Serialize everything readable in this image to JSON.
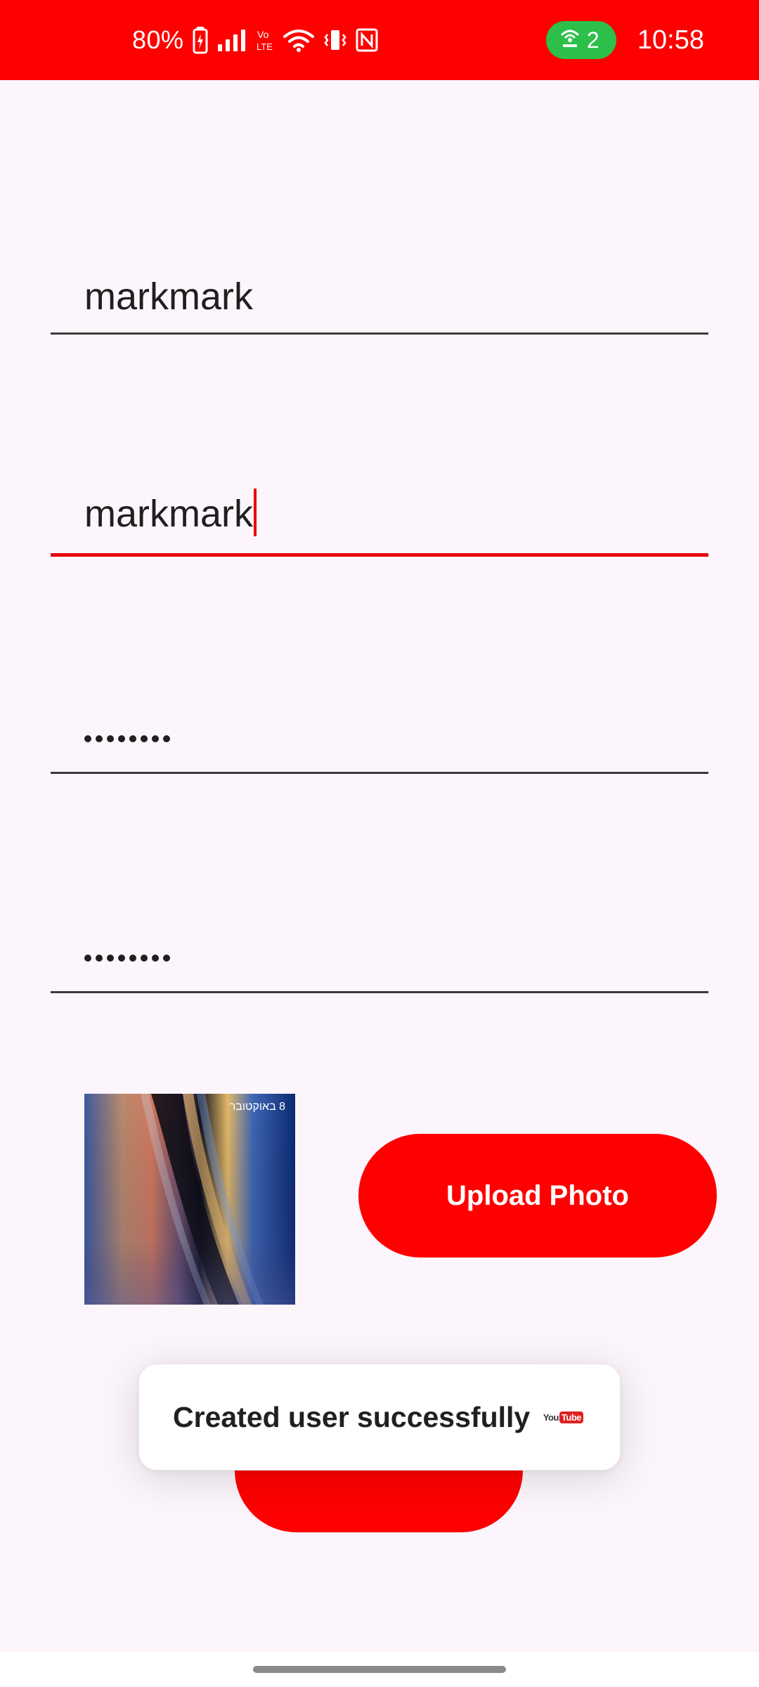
{
  "status_bar": {
    "battery_percent": "80%",
    "network_label": "Vo LTE",
    "hotspot_count": "2",
    "time": "10:58",
    "icons": [
      "battery-charging-icon",
      "signal-bars-icon",
      "volte-icon",
      "wifi-icon",
      "vibrate-icon",
      "nfc-icon",
      "hotspot-icon"
    ]
  },
  "form": {
    "username_value": "markmark",
    "email_value": "markmark",
    "password_dots": 8,
    "confirm_password_dots": 8
  },
  "photo": {
    "overlay_text": "8 באוקטובר"
  },
  "upload_button": {
    "label": "Upload Photo"
  },
  "toast": {
    "message": "Created user successfully",
    "icon": "youtube-logo-icon",
    "logo_you": "You",
    "logo_tube": "Tube"
  },
  "colors": {
    "primary": "#FF0000",
    "background": "#FCF6FC",
    "focus_underline": "#E8000B",
    "hotspot_green": "#2DBF4A"
  }
}
